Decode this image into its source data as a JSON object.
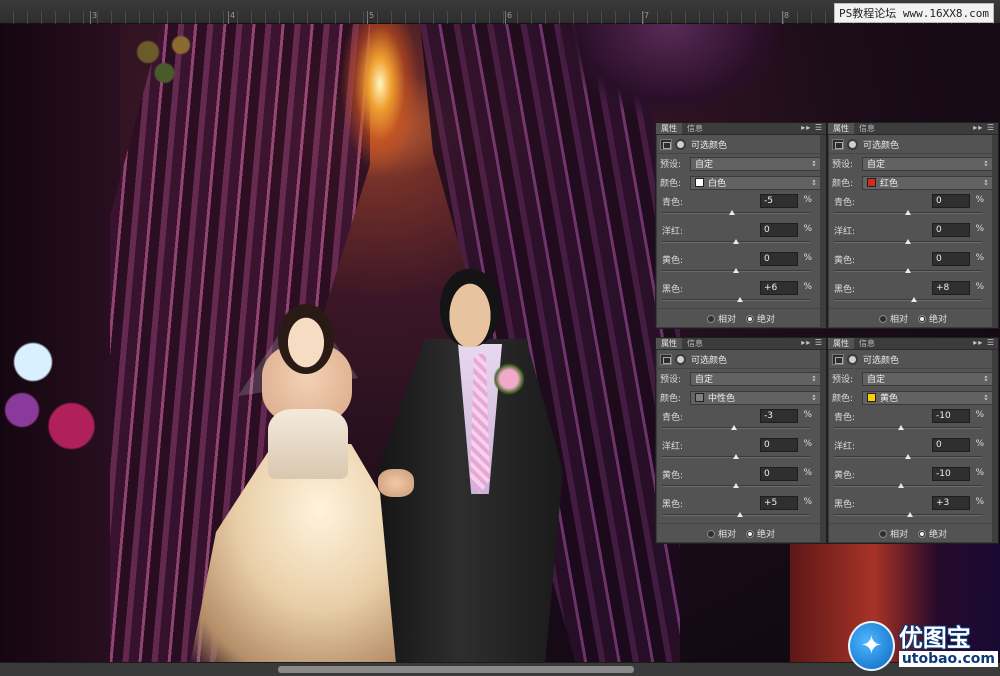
{
  "ruler": {
    "numbers": [
      "3",
      "4",
      "5",
      "6",
      "7",
      "8"
    ]
  },
  "watermark": "PS教程论坛 www.16XX8.com",
  "logo": {
    "cn": "优图宝",
    "en": "utobao.com"
  },
  "panels": [
    {
      "tabs": [
        "属性",
        "信息"
      ],
      "title": "可选颜色",
      "preset_label": "预设:",
      "preset_value": "自定",
      "color_label": "颜色:",
      "color_value": "白色",
      "swatch_color": "#ffffff",
      "sliders": [
        {
          "label": "青色:",
          "value": "-5",
          "level": -5
        },
        {
          "label": "洋红:",
          "value": "0",
          "level": 0
        },
        {
          "label": "黄色:",
          "value": "0",
          "level": 0
        },
        {
          "label": "黑色:",
          "value": "+6",
          "level": 6
        }
      ],
      "radio_relative": "相对",
      "radio_absolute": "绝对",
      "selected": "absolute"
    },
    {
      "tabs": [
        "属性",
        "信息"
      ],
      "title": "可选颜色",
      "preset_label": "预设:",
      "preset_value": "自定",
      "color_label": "颜色:",
      "color_value": "红色",
      "swatch_color": "#d42a1a",
      "sliders": [
        {
          "label": "青色:",
          "value": "0",
          "level": 0
        },
        {
          "label": "洋红:",
          "value": "0",
          "level": 0
        },
        {
          "label": "黄色:",
          "value": "0",
          "level": 0
        },
        {
          "label": "黑色:",
          "value": "+8",
          "level": 8
        }
      ],
      "radio_relative": "相对",
      "radio_absolute": "绝对",
      "selected": "absolute"
    },
    {
      "tabs": [
        "属性",
        "信息"
      ],
      "title": "可选颜色",
      "preset_label": "预设:",
      "preset_value": "自定",
      "color_label": "颜色:",
      "color_value": "中性色",
      "swatch_color": "#808080",
      "sliders": [
        {
          "label": "青色:",
          "value": "-3",
          "level": -3
        },
        {
          "label": "洋红:",
          "value": "0",
          "level": 0
        },
        {
          "label": "黄色:",
          "value": "0",
          "level": 0
        },
        {
          "label": "黑色:",
          "value": "+5",
          "level": 5
        }
      ],
      "radio_relative": "相对",
      "radio_absolute": "绝对",
      "selected": "absolute"
    },
    {
      "tabs": [
        "属性",
        "信息"
      ],
      "title": "可选颜色",
      "preset_label": "预设:",
      "preset_value": "自定",
      "color_label": "颜色:",
      "color_value": "黄色",
      "swatch_color": "#f5d000",
      "sliders": [
        {
          "label": "青色:",
          "value": "-10",
          "level": -10
        },
        {
          "label": "洋红:",
          "value": "0",
          "level": 0
        },
        {
          "label": "黄色:",
          "value": "-10",
          "level": -10
        },
        {
          "label": "黑色:",
          "value": "+3",
          "level": 3
        }
      ],
      "radio_relative": "相对",
      "radio_absolute": "绝对",
      "selected": "absolute"
    }
  ]
}
